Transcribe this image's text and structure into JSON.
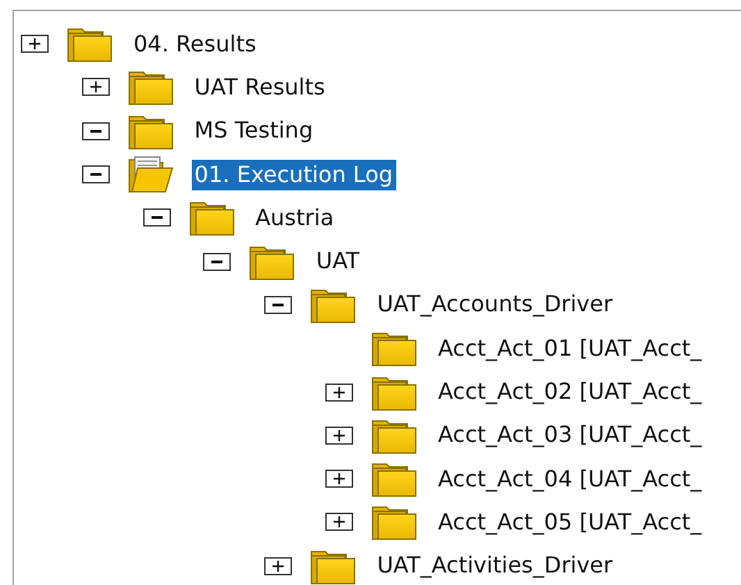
{
  "tree": [
    {
      "label": "04. Results",
      "expanded": false,
      "open": false,
      "selected": false,
      "children": [
        {
          "label": "UAT Results",
          "expanded": false,
          "open": false,
          "selected": false
        },
        {
          "label": "MS Testing",
          "expanded": true,
          "open": false,
          "selected": false
        },
        {
          "label": "01. Execution Log",
          "expanded": true,
          "open": true,
          "selected": true,
          "children": [
            {
              "label": "Austria",
              "expanded": true,
              "open": false,
              "selected": false,
              "children": [
                {
                  "label": "UAT",
                  "expanded": true,
                  "open": false,
                  "selected": false,
                  "children": [
                    {
                      "label": "UAT_Accounts_Driver",
                      "expanded": true,
                      "open": false,
                      "selected": false,
                      "children": [
                        {
                          "label": "Acct_Act_01 [UAT_Acct_",
                          "open": false,
                          "selected": false
                        },
                        {
                          "label": "Acct_Act_02 [UAT_Acct_",
                          "expanded": false,
                          "open": false,
                          "selected": false
                        },
                        {
                          "label": "Acct_Act_03 [UAT_Acct_",
                          "expanded": false,
                          "open": false,
                          "selected": false
                        },
                        {
                          "label": "Acct_Act_04 [UAT_Acct_",
                          "expanded": false,
                          "open": false,
                          "selected": false
                        },
                        {
                          "label": "Acct_Act_05 [UAT_Acct_",
                          "expanded": false,
                          "open": false,
                          "selected": false
                        }
                      ]
                    },
                    {
                      "label": "UAT_Activities_Driver",
                      "expanded": false,
                      "open": false,
                      "selected": false
                    }
                  ]
                }
              ]
            }
          ]
        }
      ]
    }
  ]
}
